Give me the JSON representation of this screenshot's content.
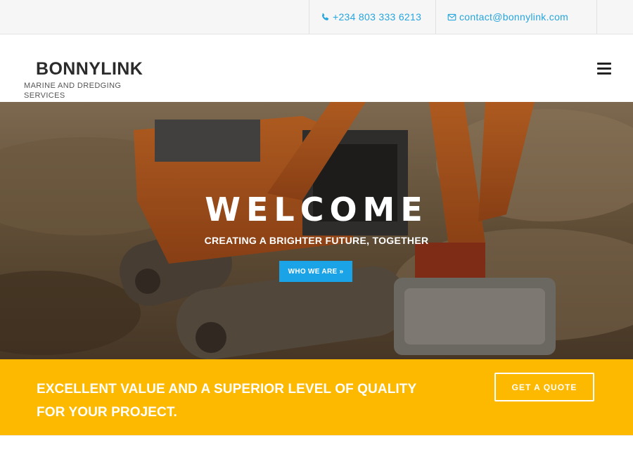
{
  "topbar": {
    "phone": "+234 803 333 6213",
    "email": "contact@bonnylink.com",
    "phone_icon": "phone-icon",
    "email_icon": "envelope-icon"
  },
  "header": {
    "brand_name": "BONNYLINK",
    "brand_tagline": "MARINE AND DREDGING SERVICES",
    "menu_icon": "hamburger-menu-icon"
  },
  "hero": {
    "title": "WELCOME",
    "subtitle": "CREATING A BRIGHTER FUTURE, TOGETHER",
    "button_label": "WHO WE ARE »",
    "image": "excavator-photo",
    "button_color": "#1aa3e6"
  },
  "banner": {
    "line1": "EXCELLENT VALUE AND A SUPERIOR LEVEL OF QUALITY",
    "line2": "FOR YOUR PROJECT.",
    "button_label": "GET A QUOTE",
    "background_color": "#fcb900"
  },
  "colors": {
    "accent_link": "#27a5de",
    "brand_text": "#2b2b2b"
  }
}
